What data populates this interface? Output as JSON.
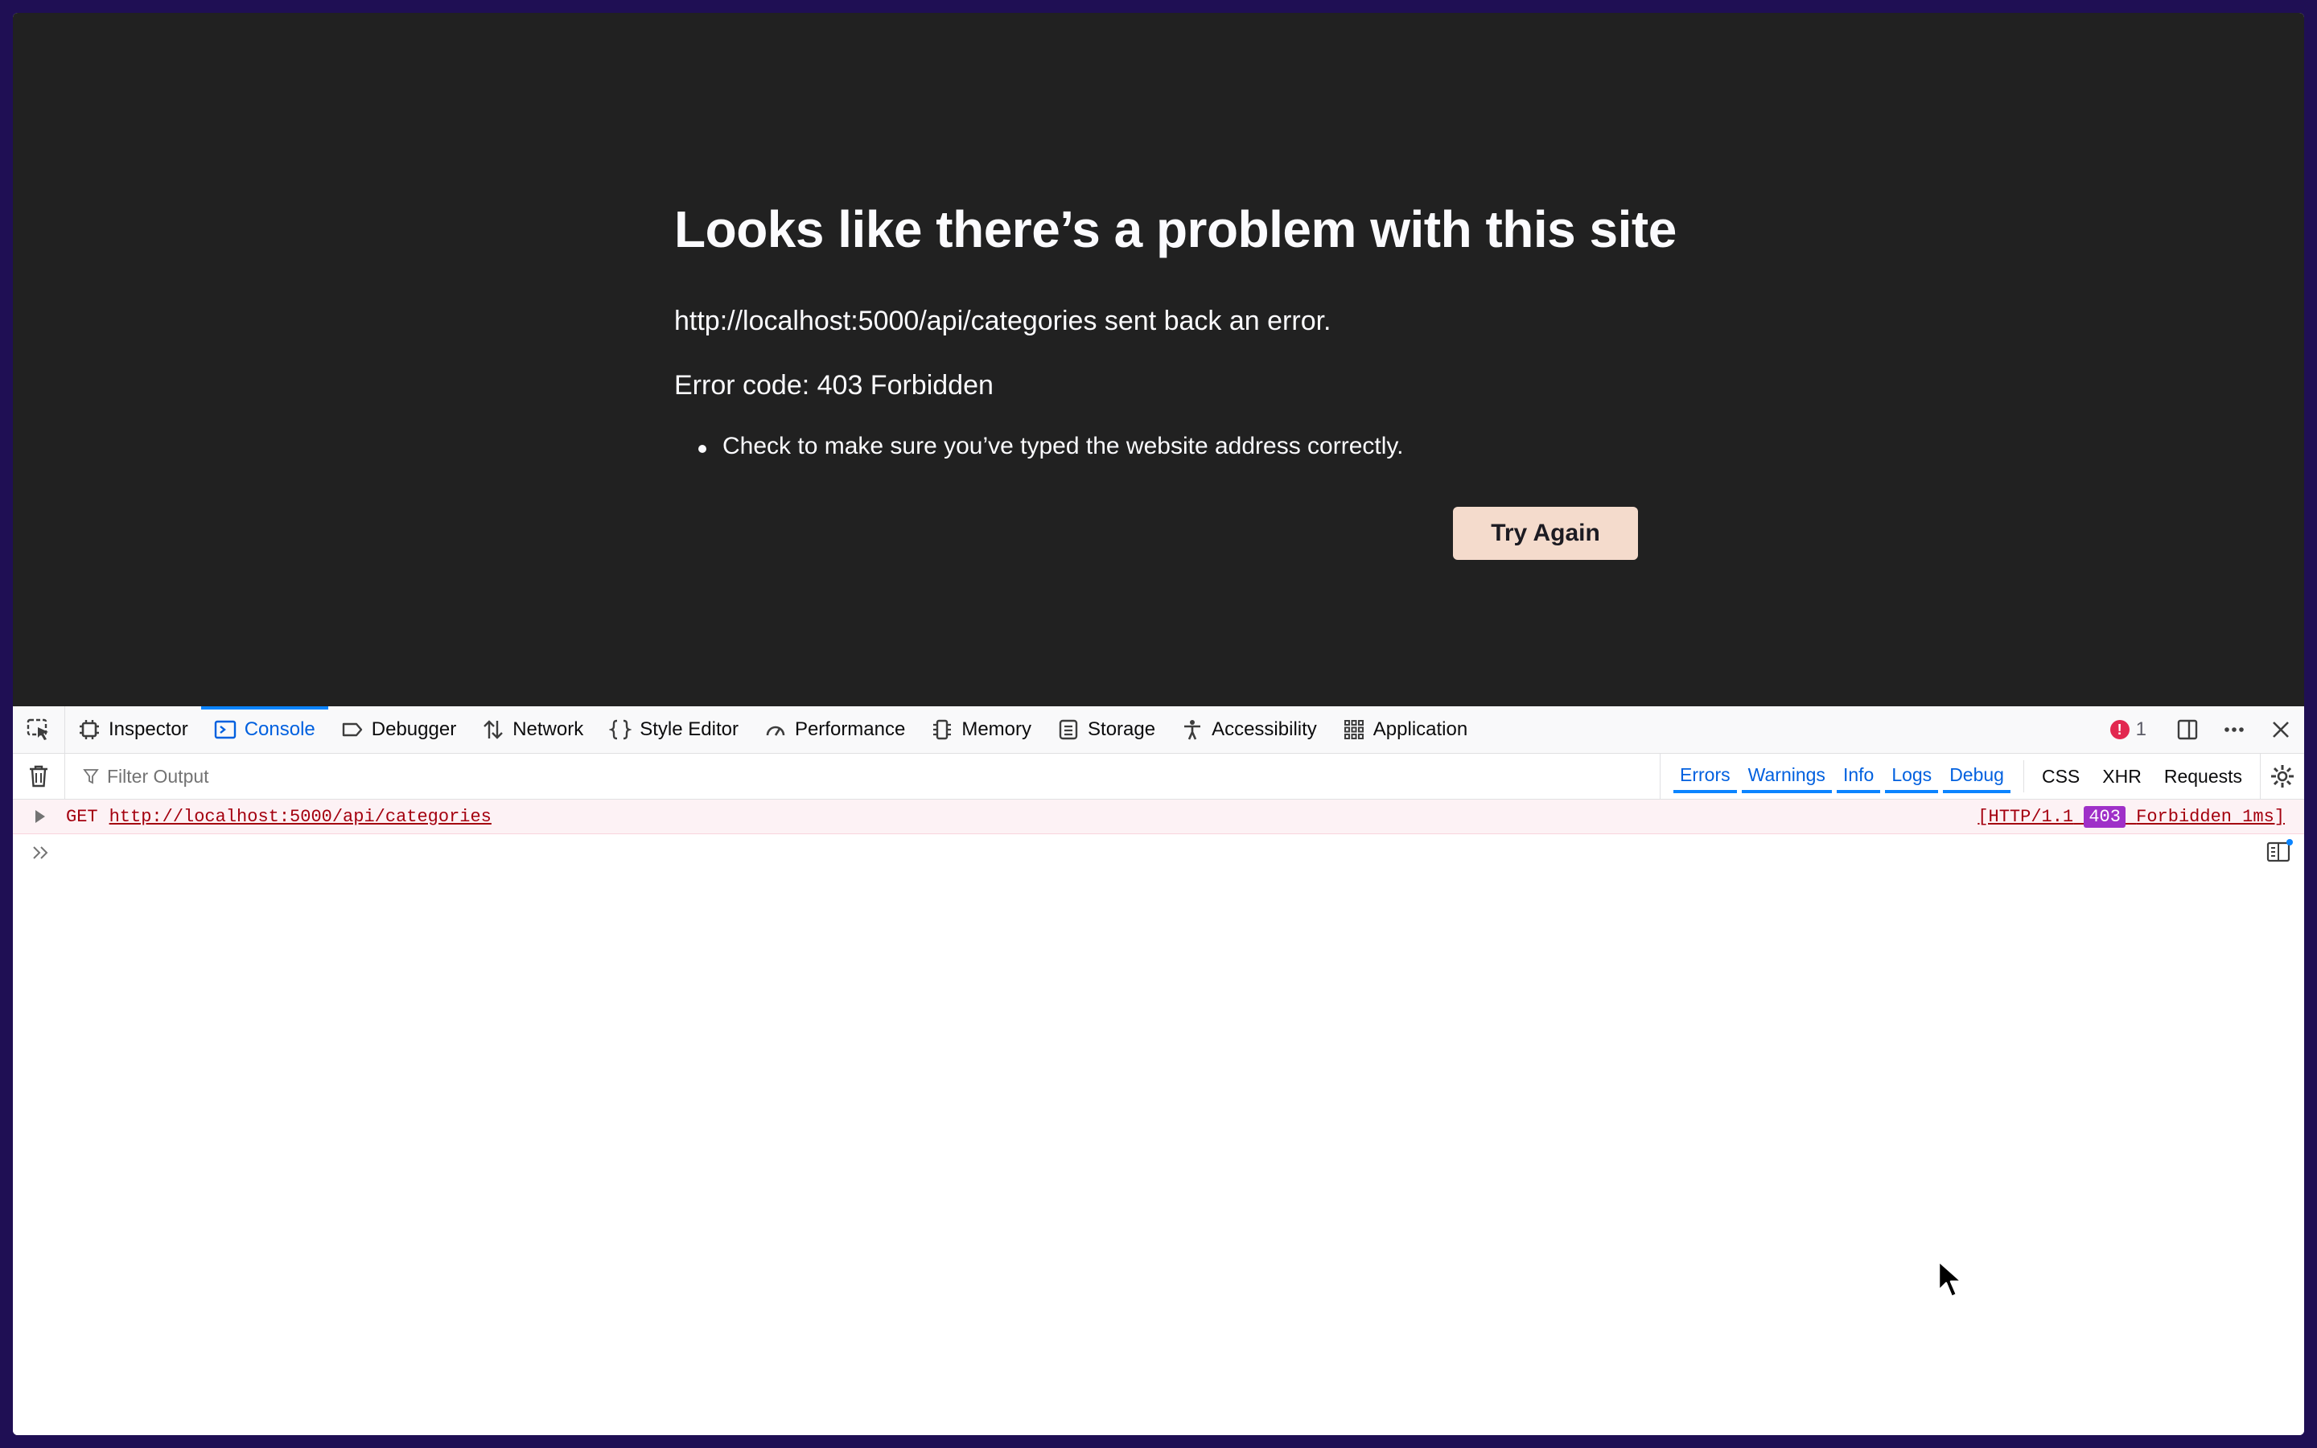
{
  "page": {
    "title": "Looks like there’s a problem with this site",
    "url_message": "http://localhost:5000/api/categories sent back an error.",
    "error_code": "Error code: 403 Forbidden",
    "hints": [
      "Check to make sure you’ve typed the website address correctly."
    ],
    "try_again_label": "Try Again"
  },
  "devtools": {
    "tabs": [
      {
        "label": "Inspector",
        "icon": "inspector-icon"
      },
      {
        "label": "Console",
        "icon": "console-icon",
        "active": true
      },
      {
        "label": "Debugger",
        "icon": "debugger-icon"
      },
      {
        "label": "Network",
        "icon": "network-icon"
      },
      {
        "label": "Style Editor",
        "icon": "style-editor-icon"
      },
      {
        "label": "Performance",
        "icon": "performance-icon"
      },
      {
        "label": "Memory",
        "icon": "memory-icon"
      },
      {
        "label": "Storage",
        "icon": "storage-icon"
      },
      {
        "label": "Accessibility",
        "icon": "accessibility-icon"
      },
      {
        "label": "Application",
        "icon": "application-icon"
      }
    ],
    "error_count": "1",
    "filter": {
      "placeholder": "Filter Output",
      "value": ""
    },
    "levels": [
      "Errors",
      "Warnings",
      "Info",
      "Logs",
      "Debug"
    ],
    "extras": [
      "CSS",
      "XHR",
      "Requests"
    ],
    "messages": [
      {
        "method": "GET",
        "url": "http://localhost:5000/api/categories",
        "status_prefix": "[HTTP/1.1",
        "status_code": "403",
        "status_suffix": "Forbidden 1ms]"
      }
    ]
  },
  "colors": {
    "page_bg": "#212121",
    "try_again_bg": "#f4dbcc",
    "active_tab": "#0060df",
    "error_row_bg": "#fdf2f5",
    "error_text": "#a4000f",
    "status_badge": "#9f30c8"
  }
}
